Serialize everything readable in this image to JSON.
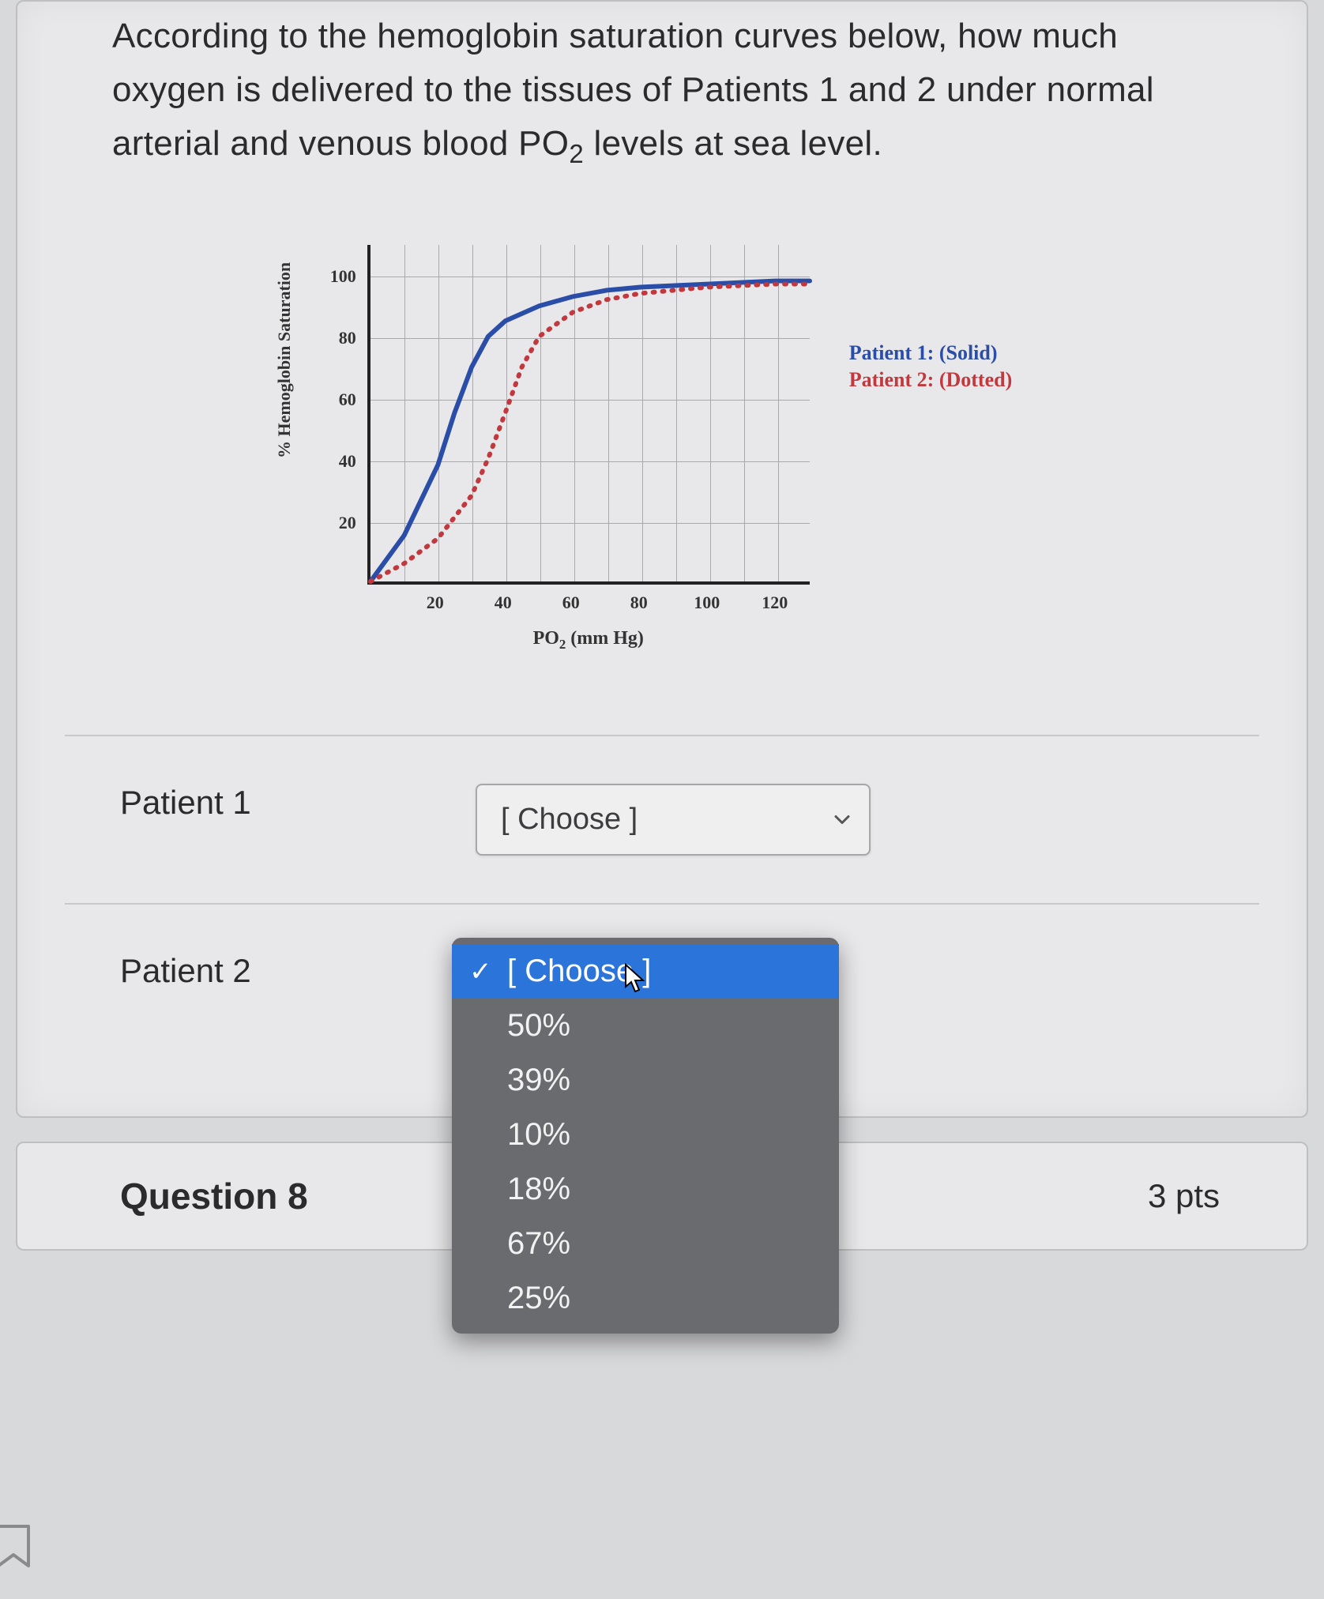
{
  "question": {
    "text_before_sub": "According to the hemoglobin saturation curves below, how much oxygen is delivered to the tissues of Patients 1 and 2 under normal arterial and venous blood  PO",
    "sub": "2",
    "text_after_sub": " levels at sea level."
  },
  "chart_data": {
    "type": "line",
    "xlabel_pre": "PO",
    "xlabel_sub": "2",
    "xlabel_post": " (mm Hg)",
    "ylabel": "% Hemoglobin Saturation",
    "xlim": [
      0,
      130
    ],
    "ylim": [
      0,
      110
    ],
    "x_ticks": [
      20,
      40,
      60,
      80,
      100,
      120
    ],
    "y_ticks": [
      20,
      40,
      60,
      80,
      100
    ],
    "legend": {
      "p1": "Patient 1: (Solid)",
      "p2": "Patient 2: (Dotted)"
    },
    "series": [
      {
        "name": "Patient 1 (Solid)",
        "style": "solid",
        "color": "#2a4da8",
        "x": [
          0,
          10,
          20,
          25,
          30,
          35,
          40,
          50,
          60,
          70,
          80,
          100,
          120,
          130
        ],
        "y": [
          0,
          15,
          38,
          55,
          70,
          80,
          85,
          90,
          93,
          95,
          96,
          97,
          98,
          98
        ]
      },
      {
        "name": "Patient 2 (Dotted)",
        "style": "dotted",
        "color": "#c1393f",
        "x": [
          0,
          10,
          20,
          30,
          35,
          40,
          45,
          50,
          60,
          70,
          80,
          100,
          120,
          130
        ],
        "y": [
          0,
          6,
          14,
          28,
          40,
          55,
          70,
          80,
          88,
          92,
          94,
          96,
          97,
          97
        ]
      }
    ]
  },
  "answers": {
    "patient1_label": "Patient 1",
    "patient2_label": "Patient 2",
    "choose_placeholder": "[ Choose ]",
    "dropdown_options": [
      "[ Choose ]",
      "50%",
      "39%",
      "10%",
      "18%",
      "67%",
      "25%"
    ]
  },
  "footer": {
    "title": "Question 8",
    "points": "3 pts"
  }
}
